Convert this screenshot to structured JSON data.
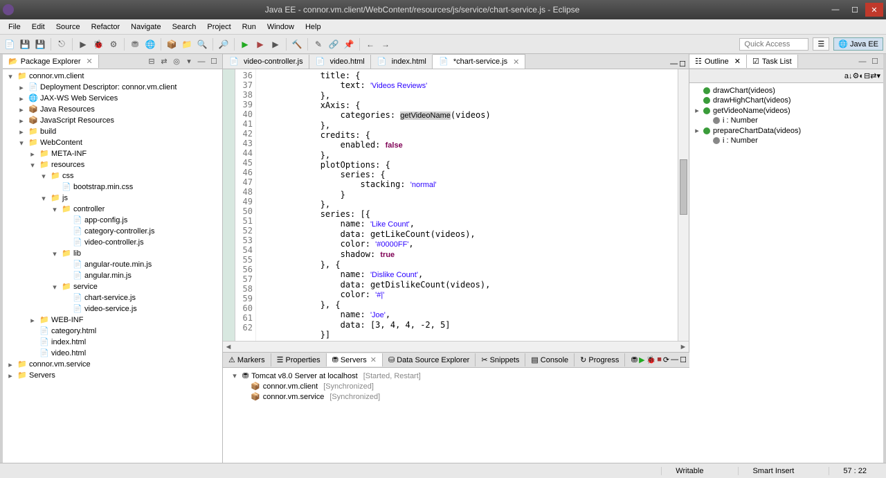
{
  "window": {
    "title": "Java EE - connor.vm.client/WebContent/resources/js/service/chart-service.js - Eclipse"
  },
  "menu": [
    "File",
    "Edit",
    "Source",
    "Refactor",
    "Navigate",
    "Search",
    "Project",
    "Run",
    "Window",
    "Help"
  ],
  "quick_access": {
    "placeholder": "Quick Access"
  },
  "perspective": {
    "label": "Java EE"
  },
  "project_explorer": {
    "title": "Package Explorer",
    "nodes": {
      "p1": "connor.vm.client",
      "p1a": "Deployment Descriptor: connor.vm.client",
      "p1b": "JAX-WS Web Services",
      "p1c": "Java Resources",
      "p1d": "JavaScript Resources",
      "p1e": "build",
      "p1f": "WebContent",
      "p1f1": "META-INF",
      "p1f2": "resources",
      "p1f2a": "css",
      "p1f2a1": "bootstrap.min.css",
      "p1f2b": "js",
      "p1f2b1": "controller",
      "p1f2b1a": "app-config.js",
      "p1f2b1b": "category-controller.js",
      "p1f2b1c": "video-controller.js",
      "p1f2b2": "lib",
      "p1f2b2a": "angular-route.min.js",
      "p1f2b2b": "angular.min.js",
      "p1f2b3": "service",
      "p1f2b3a": "chart-service.js",
      "p1f2b3b": "video-service.js",
      "p1f3": "WEB-INF",
      "p1g": "category.html",
      "p1h": "index.html",
      "p1i": "video.html",
      "p2": "connor.vm.service",
      "p3": "Servers"
    }
  },
  "editor": {
    "tabs": [
      {
        "label": "video-controller.js",
        "active": false
      },
      {
        "label": "video.html",
        "active": false
      },
      {
        "label": "index.html",
        "active": false
      },
      {
        "label": "*chart-service.js",
        "active": true
      }
    ],
    "first_line": 36,
    "code_lines": [
      "            title: {",
      "                text: 'Videos Reviews'",
      "            },",
      "            xAxis: {",
      "                categories: getVideoName(videos)",
      "            },",
      "            credits: {",
      "                enabled: false",
      "            },",
      "            plotOptions: {",
      "                series: {",
      "                    stacking: 'normal'",
      "                }",
      "            },",
      "            series: [{",
      "                name: 'Like Count',",
      "                data: getLikeCount(videos),",
      "                color: '#0000FF',",
      "                shadow: true",
      "            }, {",
      "                name: 'Dislike Count',",
      "                data: getDislikeCount(videos),",
      "                color: '#|'",
      "            }, {",
      "                name: 'Joe',",
      "                data: [3, 4, 4, -2, 5]",
      "            }]"
    ]
  },
  "outline": {
    "title": "Outline",
    "task_list": "Task List",
    "items": [
      {
        "name": "drawChart(videos)",
        "kind": "green"
      },
      {
        "name": "drawHighChart(videos)",
        "kind": "green"
      },
      {
        "name": "getVideoName(videos)",
        "kind": "green",
        "expandable": true
      },
      {
        "name": "i : Number",
        "kind": "gray",
        "indent": 1
      },
      {
        "name": "prepareChartData(videos)",
        "kind": "green",
        "expandable": false
      },
      {
        "name": "i : Number",
        "kind": "gray",
        "indent": 1
      }
    ]
  },
  "bottom_tabs": [
    "Markers",
    "Properties",
    "Servers",
    "Data Source Explorer",
    "Snippets",
    "Console",
    "Progress"
  ],
  "bottom_active": 2,
  "servers": {
    "root": "Tomcat v8.0 Server at localhost",
    "root_state": "[Started, Restart]",
    "modules": [
      {
        "name": "connor.vm.client",
        "state": "[Synchronized]"
      },
      {
        "name": "connor.vm.service",
        "state": "[Synchronized]"
      }
    ]
  },
  "status": {
    "writable": "Writable",
    "insert": "Smart Insert",
    "pos": "57 : 22"
  }
}
